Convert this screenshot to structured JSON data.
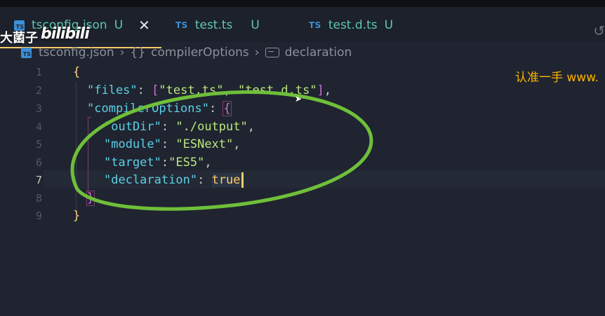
{
  "tabs": [
    {
      "label": "tsconfig.json",
      "status": "U",
      "active": true
    },
    {
      "label": "test.ts",
      "status": "U",
      "active": false
    },
    {
      "label": "test.d.ts",
      "status": "U",
      "active": false
    }
  ],
  "tab_badge": "TS",
  "breadcrumb": {
    "file": "tsconfig.json",
    "level1": "compilerOptions",
    "level2": "declaration",
    "level1_icon": "{}"
  },
  "watermark": {
    "uploader": "大菌子",
    "site": "bilibili",
    "right_text": "认准一手 www."
  },
  "line_numbers": [
    "1",
    "2",
    "3",
    "4",
    "5",
    "6",
    "7",
    "8",
    "9"
  ],
  "code": {
    "l1_open": "{",
    "files_key": "\"files\"",
    "files_v1": "\"test.ts\"",
    "files_v2": "\"test.d.ts\"",
    "co_key": "\"compilerOptions\"",
    "co_open": "{",
    "outdir_key": "\"outDir\"",
    "outdir_val": "\"./output\"",
    "module_key": "\"module\"",
    "module_val": "\"ESNext\"",
    "target_key": "\"target\"",
    "target_val": "\"ES5\"",
    "decl_key": "\"declaration\"",
    "decl_val": "true",
    "co_close": "}",
    "l9_close": "}"
  },
  "colors": {
    "annotation_ellipse": "#6fbf3a",
    "accent": "#ffcc66"
  }
}
